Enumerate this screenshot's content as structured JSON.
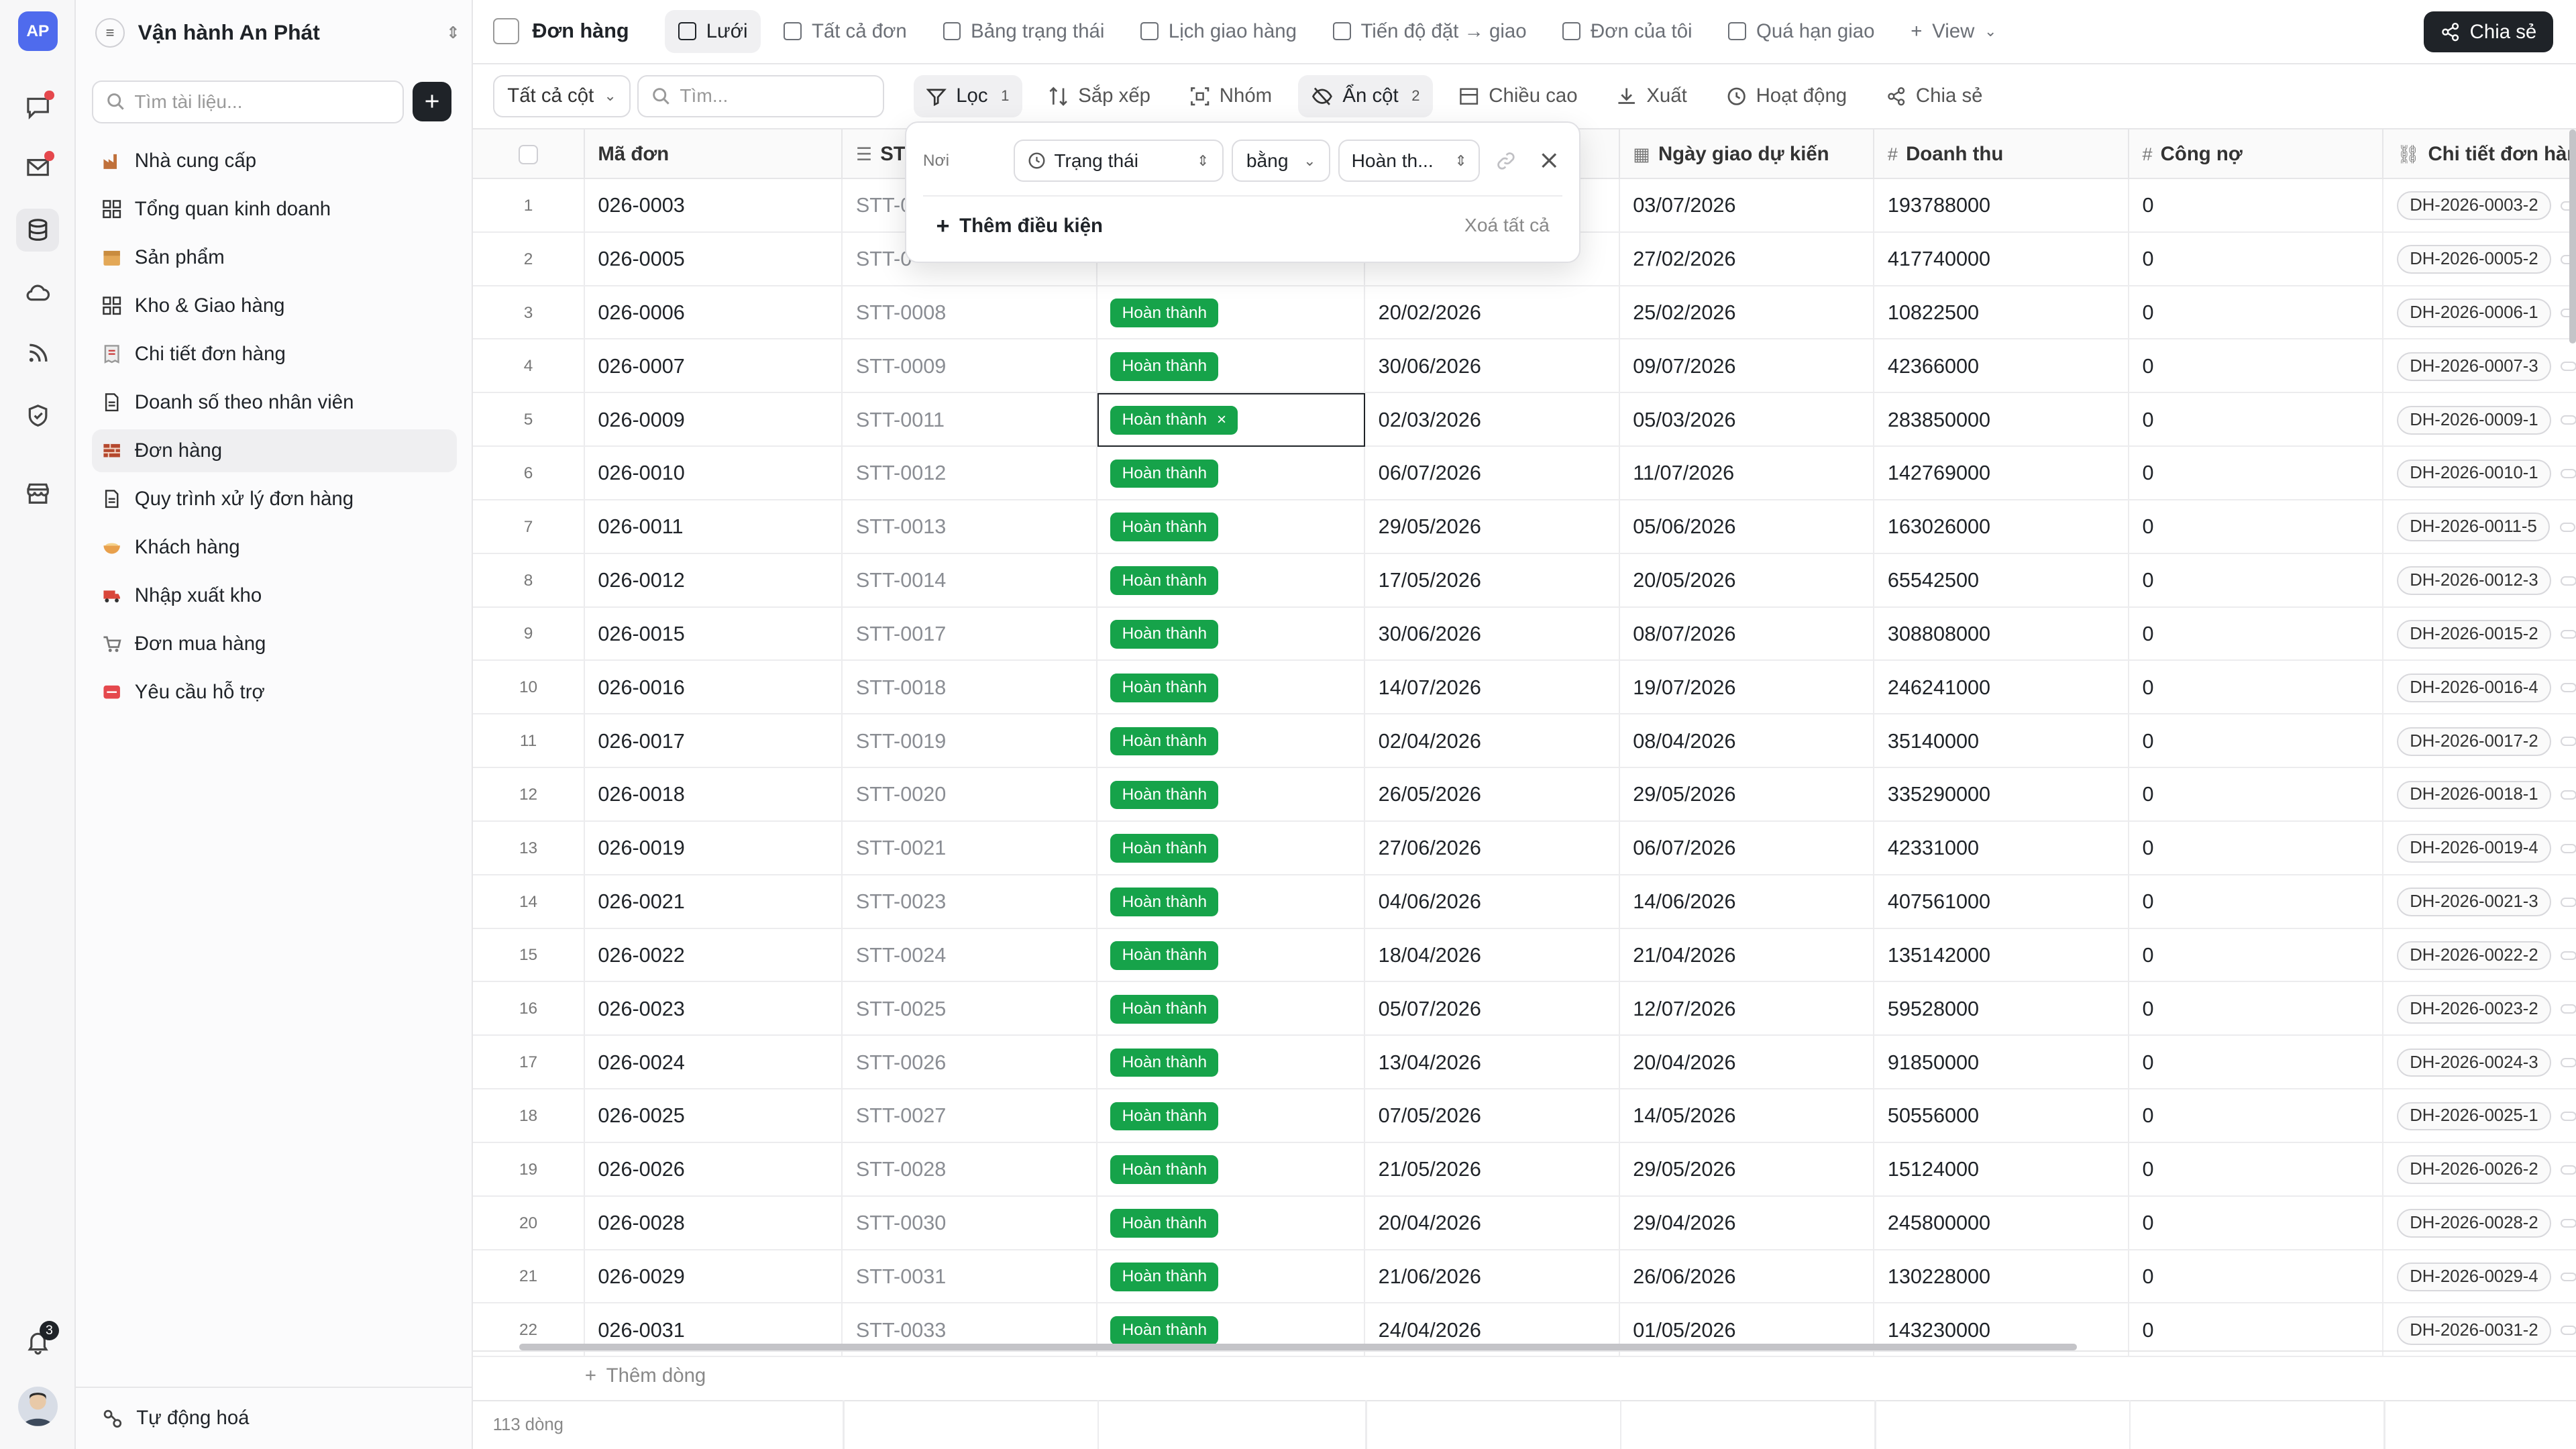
{
  "rail": {
    "logo": "AP",
    "notification_count": "3",
    "colors": {
      "accent": "#4f6bed",
      "alert": "#e5484d"
    }
  },
  "sidebar": {
    "workspace_name": "Vận hành An Phát",
    "search_placeholder": "Tìm tài liệu...",
    "items": [
      {
        "label": "Nhà cung cấp",
        "icon": "factory-icon"
      },
      {
        "label": "Tổng quan kinh doanh",
        "icon": "grid-icon"
      },
      {
        "label": "Sản phẩm",
        "icon": "box-icon"
      },
      {
        "label": "Kho & Giao hàng",
        "icon": "grid-icon"
      },
      {
        "label": "Chi tiết đơn hàng",
        "icon": "receipt-icon"
      },
      {
        "label": "Doanh số theo nhân viên",
        "icon": "document-icon"
      },
      {
        "label": "Đơn hàng",
        "icon": "brick-icon",
        "active": true
      },
      {
        "label": "Quy trình xử lý đơn hàng",
        "icon": "document-icon"
      },
      {
        "label": "Khách hàng",
        "icon": "bowl-icon"
      },
      {
        "label": "Nhập xuất kho",
        "icon": "truck-icon"
      },
      {
        "label": "Đơn mua hàng",
        "icon": "cart-icon"
      },
      {
        "label": "Yêu cầu hỗ trợ",
        "icon": "sos-icon"
      }
    ],
    "automation_label": "Tự động hoá"
  },
  "tabbar": {
    "title": "Đơn hàng",
    "tabs": [
      {
        "label": "Lưới",
        "active": true
      },
      {
        "label": "Tất cả đơn"
      },
      {
        "label": "Bảng trạng thái"
      },
      {
        "label": "Lịch giao hàng"
      },
      {
        "label": "Tiến độ đặt → giao"
      },
      {
        "label": "Đơn của tôi"
      },
      {
        "label": "Quá hạn giao"
      }
    ],
    "add_view_label": "View",
    "share_label": "Chia sẻ"
  },
  "toolbar": {
    "column_select": "Tất cả cột",
    "search_placeholder": "Tìm...",
    "filter_label": "Lọc",
    "filter_count": "1",
    "sort_label": "Sắp xếp",
    "group_label": "Nhóm",
    "hide_label": "Ẩn cột",
    "hide_count": "2",
    "height_label": "Chiều cao",
    "export_label": "Xuất",
    "activity_label": "Hoạt động",
    "share_label": "Chia sẻ"
  },
  "filter_popover": {
    "where_label": "Nơi",
    "field": "Trạng thái",
    "operator": "bằng",
    "value": "Hoàn th...",
    "add_condition": "Thêm điều kiện",
    "clear_all": "Xoá tất cả"
  },
  "grid": {
    "columns": [
      "Mã đơn",
      "STT",
      "Ngày giao dự kiến",
      "Doanh thu",
      "Công nợ",
      "Chi tiết đơn hàng"
    ],
    "status_label": "Hoàn thành",
    "status_color": "#16a34a",
    "rows": [
      {
        "n": "1",
        "code": "026-0003",
        "stt": "STT-0",
        "order_date": "",
        "delivery": "03/07/2026",
        "revenue": "193788000",
        "debt": "0",
        "detail": "DH-2026-0003-2"
      },
      {
        "n": "2",
        "code": "026-0005",
        "stt": "STT-0",
        "order_date": "",
        "delivery": "27/02/2026",
        "revenue": "417740000",
        "debt": "0",
        "detail": "DH-2026-0005-2"
      },
      {
        "n": "3",
        "code": "026-0006",
        "stt": "STT-0008",
        "order_date": "20/02/2026",
        "delivery": "25/02/2026",
        "revenue": "10822500",
        "debt": "0",
        "detail": "DH-2026-0006-1"
      },
      {
        "n": "4",
        "code": "026-0007",
        "stt": "STT-0009",
        "order_date": "30/06/2026",
        "delivery": "09/07/2026",
        "revenue": "42366000",
        "debt": "0",
        "detail": "DH-2026-0007-3"
      },
      {
        "n": "5",
        "code": "026-0009",
        "stt": "STT-0011",
        "order_date": "02/03/2026",
        "delivery": "05/03/2026",
        "revenue": "283850000",
        "debt": "0",
        "detail": "DH-2026-0009-1"
      },
      {
        "n": "6",
        "code": "026-0010",
        "stt": "STT-0012",
        "order_date": "06/07/2026",
        "delivery": "11/07/2026",
        "revenue": "142769000",
        "debt": "0",
        "detail": "DH-2026-0010-1"
      },
      {
        "n": "7",
        "code": "026-0011",
        "stt": "STT-0013",
        "order_date": "29/05/2026",
        "delivery": "05/06/2026",
        "revenue": "163026000",
        "debt": "0",
        "detail": "DH-2026-0011-5"
      },
      {
        "n": "8",
        "code": "026-0012",
        "stt": "STT-0014",
        "order_date": "17/05/2026",
        "delivery": "20/05/2026",
        "revenue": "65542500",
        "debt": "0",
        "detail": "DH-2026-0012-3"
      },
      {
        "n": "9",
        "code": "026-0015",
        "stt": "STT-0017",
        "order_date": "30/06/2026",
        "delivery": "08/07/2026",
        "revenue": "308808000",
        "debt": "0",
        "detail": "DH-2026-0015-2"
      },
      {
        "n": "10",
        "code": "026-0016",
        "stt": "STT-0018",
        "order_date": "14/07/2026",
        "delivery": "19/07/2026",
        "revenue": "246241000",
        "debt": "0",
        "detail": "DH-2026-0016-4"
      },
      {
        "n": "11",
        "code": "026-0017",
        "stt": "STT-0019",
        "order_date": "02/04/2026",
        "delivery": "08/04/2026",
        "revenue": "35140000",
        "debt": "0",
        "detail": "DH-2026-0017-2"
      },
      {
        "n": "12",
        "code": "026-0018",
        "stt": "STT-0020",
        "order_date": "26/05/2026",
        "delivery": "29/05/2026",
        "revenue": "335290000",
        "debt": "0",
        "detail": "DH-2026-0018-1"
      },
      {
        "n": "13",
        "code": "026-0019",
        "stt": "STT-0021",
        "order_date": "27/06/2026",
        "delivery": "06/07/2026",
        "revenue": "42331000",
        "debt": "0",
        "detail": "DH-2026-0019-4"
      },
      {
        "n": "14",
        "code": "026-0021",
        "stt": "STT-0023",
        "order_date": "04/06/2026",
        "delivery": "14/06/2026",
        "revenue": "407561000",
        "debt": "0",
        "detail": "DH-2026-0021-3"
      },
      {
        "n": "15",
        "code": "026-0022",
        "stt": "STT-0024",
        "order_date": "18/04/2026",
        "delivery": "21/04/2026",
        "revenue": "135142000",
        "debt": "0",
        "detail": "DH-2026-0022-2"
      },
      {
        "n": "16",
        "code": "026-0023",
        "stt": "STT-0025",
        "order_date": "05/07/2026",
        "delivery": "12/07/2026",
        "revenue": "59528000",
        "debt": "0",
        "detail": "DH-2026-0023-2"
      },
      {
        "n": "17",
        "code": "026-0024",
        "stt": "STT-0026",
        "order_date": "13/04/2026",
        "delivery": "20/04/2026",
        "revenue": "91850000",
        "debt": "0",
        "detail": "DH-2026-0024-3"
      },
      {
        "n": "18",
        "code": "026-0025",
        "stt": "STT-0027",
        "order_date": "07/05/2026",
        "delivery": "14/05/2026",
        "revenue": "50556000",
        "debt": "0",
        "detail": "DH-2026-0025-1"
      },
      {
        "n": "19",
        "code": "026-0026",
        "stt": "STT-0028",
        "order_date": "21/05/2026",
        "delivery": "29/05/2026",
        "revenue": "15124000",
        "debt": "0",
        "detail": "DH-2026-0026-2"
      },
      {
        "n": "20",
        "code": "026-0028",
        "stt": "STT-0030",
        "order_date": "20/04/2026",
        "delivery": "29/04/2026",
        "revenue": "245800000",
        "debt": "0",
        "detail": "DH-2026-0028-2"
      },
      {
        "n": "21",
        "code": "026-0029",
        "stt": "STT-0031",
        "order_date": "21/06/2026",
        "delivery": "26/06/2026",
        "revenue": "130228000",
        "debt": "0",
        "detail": "DH-2026-0029-4"
      },
      {
        "n": "22",
        "code": "026-0031",
        "stt": "STT-0033",
        "order_date": "24/04/2026",
        "delivery": "01/05/2026",
        "revenue": "143230000",
        "debt": "0",
        "detail": "DH-2026-0031-2"
      }
    ],
    "add_row_label": "Thêm dòng",
    "row_count_label": "113 dòng"
  }
}
